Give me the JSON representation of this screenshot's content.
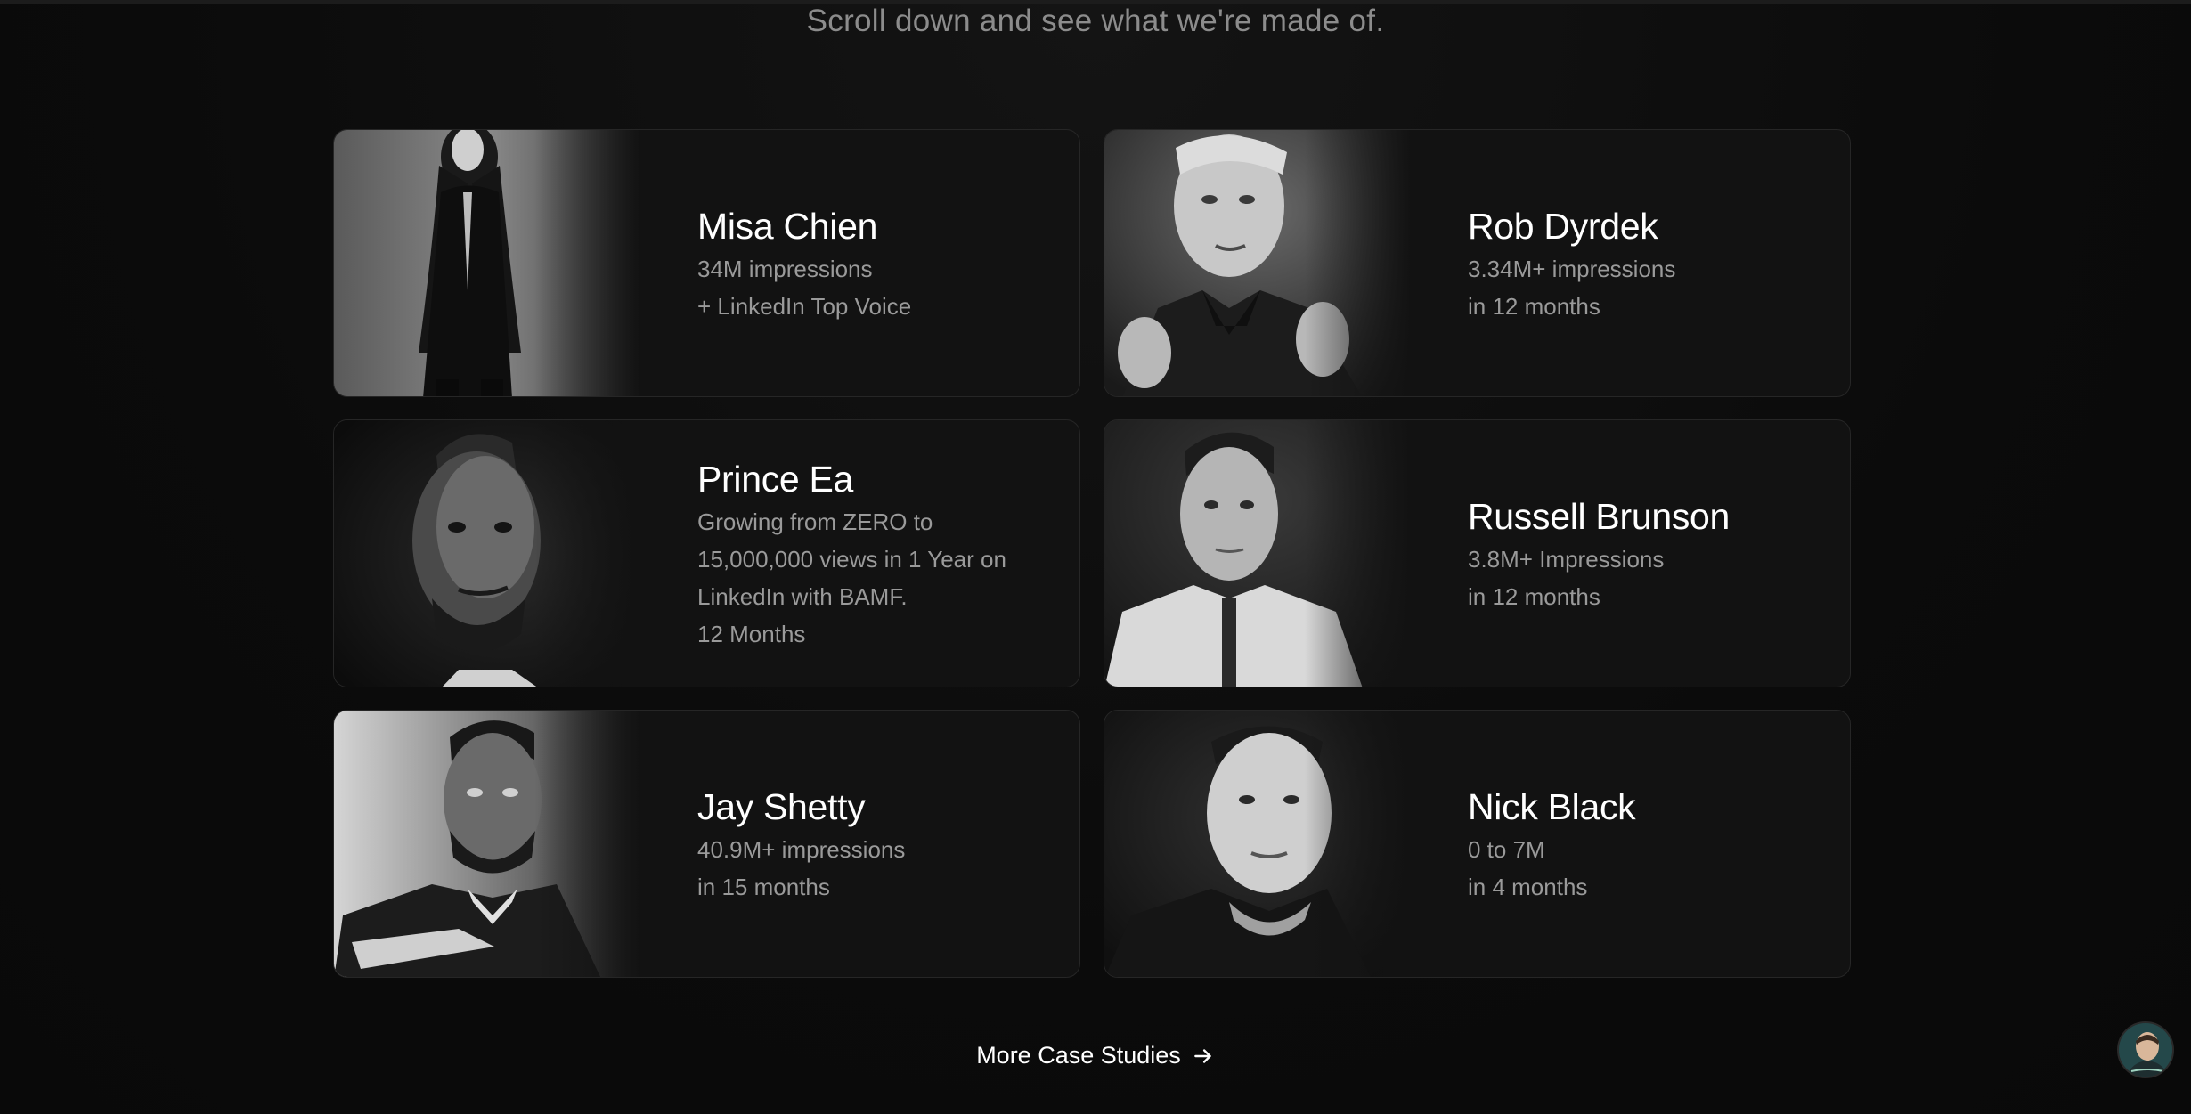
{
  "header": {
    "subtitle": "Scroll down and see what we're made of."
  },
  "case_studies": [
    {
      "name": "Misa Chien",
      "lines": [
        "34M impressions",
        "+ LinkedIn Top Voice"
      ]
    },
    {
      "name": "Rob Dyrdek",
      "lines": [
        "3.34M+ impressions",
        "in 12 months"
      ]
    },
    {
      "name": "Prince Ea",
      "lines": [
        "Growing from ZERO to",
        "15,000,000 views in 1 Year on",
        "LinkedIn with BAMF.",
        "12 Months"
      ]
    },
    {
      "name": "Russell Brunson",
      "lines": [
        "3.8M+ Impressions",
        "in 12 months"
      ]
    },
    {
      "name": "Jay Shetty",
      "lines": [
        "40.9M+ impressions",
        "in 15 months"
      ]
    },
    {
      "name": "Nick Black",
      "lines": [
        "0 to 7M",
        "in 4 months"
      ]
    }
  ],
  "cta": {
    "label": "More Case Studies",
    "icon": "arrow-right-icon"
  },
  "chat_widget": {
    "icon": "chat-avatar-icon"
  },
  "colors": {
    "background": "#0b0b0b",
    "card": "#121212",
    "card_border": "#262626",
    "text_primary": "#ffffff",
    "text_secondary": "#9a9a9a"
  }
}
